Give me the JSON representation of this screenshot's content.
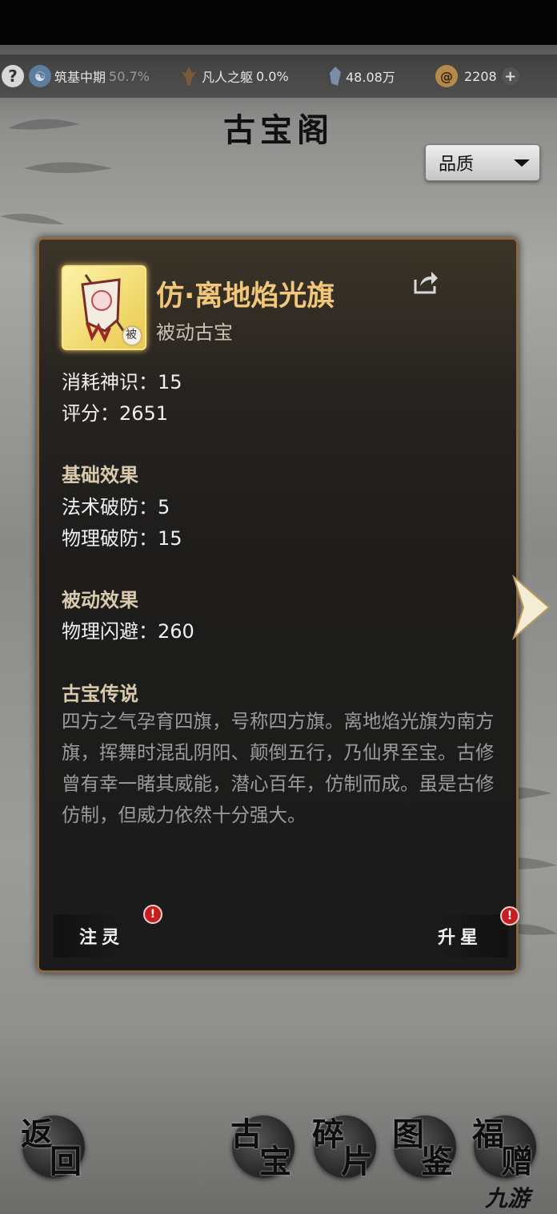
{
  "resources": {
    "realm": {
      "label": "筑基中期",
      "percent": "50.7%"
    },
    "body": {
      "label": "凡人之躯",
      "percent": "0.0%"
    },
    "stones": "48.08万",
    "currency": "2208"
  },
  "page_title": "古宝阁",
  "sort_dropdown": {
    "selected": "品质"
  },
  "item": {
    "name": "仿·离地焰光旗",
    "type": "被动古宝",
    "icon_tag": "被",
    "stats": [
      {
        "label": "消耗神识",
        "value": "15"
      },
      {
        "label": "评分",
        "value": "2651"
      }
    ],
    "base_effects_title": "基础效果",
    "base_effects": [
      {
        "label": "法术破防",
        "value": "5"
      },
      {
        "label": "物理破防",
        "value": "15"
      }
    ],
    "passive_effects_title": "被动效果",
    "passive_effects": [
      {
        "label": "物理闪避",
        "value": "260"
      }
    ],
    "lore_title": "古宝传说",
    "lore_text": "四方之气孕育四旗，号称四方旗。离地焰光旗为南方旗，挥舞时混乱阴阳、颠倒五行，乃仙界至宝。古修曾有幸一睹其威能，潜心百年，仿制而成。虽是古修仿制，但威力依然十分强大。"
  },
  "buttons": {
    "infuse": "注灵",
    "star_up": "升星",
    "badge": "!"
  },
  "bottom_nav": {
    "back": [
      "返",
      "回"
    ],
    "treasure": [
      "古",
      "宝"
    ],
    "fragment": [
      "碎",
      "片"
    ],
    "codex": [
      "图",
      "鉴"
    ],
    "gift": [
      "福",
      "赠"
    ]
  },
  "watermark": "九游",
  "icons": {
    "help": "question-icon",
    "realm": "yinyang-icon",
    "body": "figure-icon",
    "stones": "spirit-stone-icon",
    "currency": "coin-icon",
    "add": "plus-icon",
    "share": "share-icon",
    "next": "chevron-right-icon"
  },
  "colors": {
    "item_name": "#f3c77a",
    "card_border": "#8a6a43",
    "badge": "#c51f1f"
  }
}
